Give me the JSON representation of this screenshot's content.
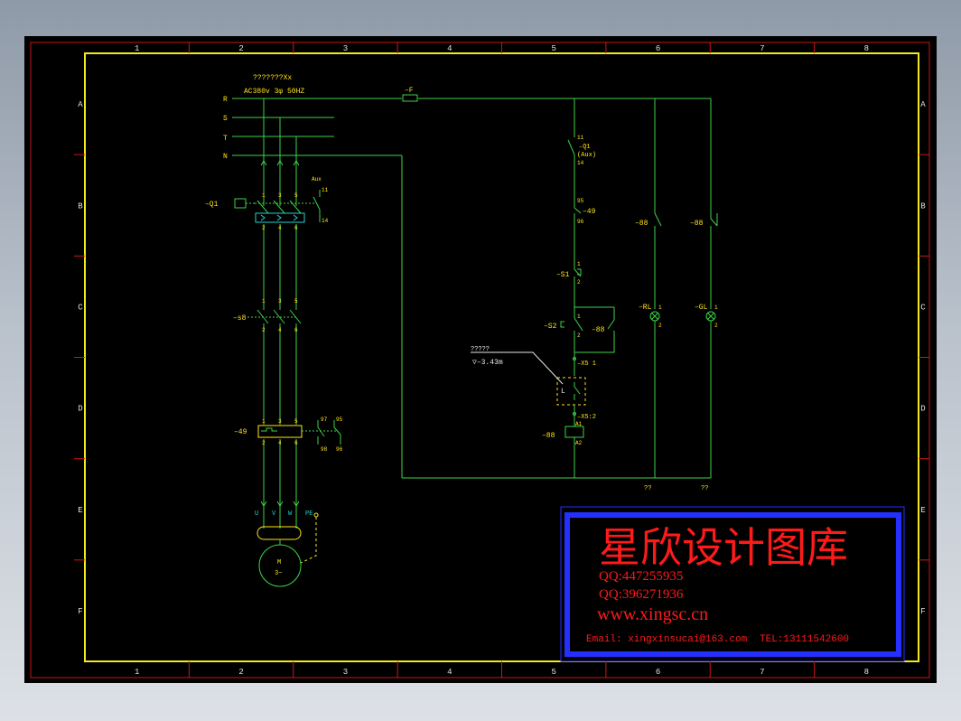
{
  "frame": {
    "cols": [
      "1",
      "2",
      "3",
      "4",
      "5",
      "6",
      "7",
      "8"
    ],
    "rows": [
      "A",
      "B",
      "C",
      "D",
      "E",
      "F"
    ]
  },
  "supply": {
    "title": "???????Xx",
    "rating": "AC380v   3φ   50HZ",
    "phases": [
      "R",
      "S",
      "T",
      "N"
    ],
    "fuse": "–F"
  },
  "breaker": {
    "label": "–Q1",
    "aux_label": "Aux",
    "pins_top": [
      "1",
      "3",
      "5"
    ],
    "pins_bottom": [
      "2",
      "4",
      "6"
    ],
    "aux_top": "11",
    "aux_bottom": "14"
  },
  "contactor_main": {
    "label": "–s8",
    "pins_top": [
      "1",
      "3",
      "5"
    ],
    "pins_bottom": [
      "2",
      "4",
      "6"
    ]
  },
  "overload": {
    "label": "–49",
    "pins_top": [
      "1",
      "3",
      "5"
    ],
    "pins_bottom": [
      "2",
      "4",
      "6"
    ],
    "aux_pins": [
      "97",
      "95",
      "98",
      "96"
    ]
  },
  "motor": {
    "terminals": [
      "U",
      "V",
      "W",
      "PE"
    ],
    "label": "M",
    "sub": "3~"
  },
  "control": {
    "q1_aux": [
      "11",
      "–Q1",
      "(Aux)",
      "14"
    ],
    "ol_contact": [
      "95",
      "–49",
      "96"
    ],
    "s1": [
      "1",
      "–S1",
      "2"
    ],
    "s2": [
      "1",
      "–S2",
      "2"
    ],
    "s2_hold": "–88",
    "x5": "–X5 1",
    "x52": "–X5:2",
    "float_title": "?????",
    "float_level": "▽–3.43m",
    "float_switch": "L",
    "coil": [
      "A1",
      "–88",
      "A2"
    ],
    "contact_rl": "–88",
    "contact_gl": "–88",
    "lamp_rl": [
      "–RL",
      "1",
      "2"
    ],
    "lamp_gl": [
      "–GL",
      "1",
      "2"
    ],
    "bottom_notes": [
      "??",
      "??"
    ]
  },
  "watermark": {
    "title": "星欣设计图库",
    "qq1": "QQ:447255935",
    "qq2": "QQ:396271936",
    "web": "www.xingsc.cn",
    "email": "Email: xingxinsucai@163.com",
    "tel": "TEL:13111542600"
  },
  "colors": {
    "background": "#000000",
    "outer_border": "#c81818",
    "inner_border": "#f2ea1c",
    "wire": "#3ed24a",
    "label": "#ffe41a",
    "terminal": "#22d2d2",
    "watermark_frame": "#2430ff",
    "watermark_text": "#ff1a1a"
  }
}
